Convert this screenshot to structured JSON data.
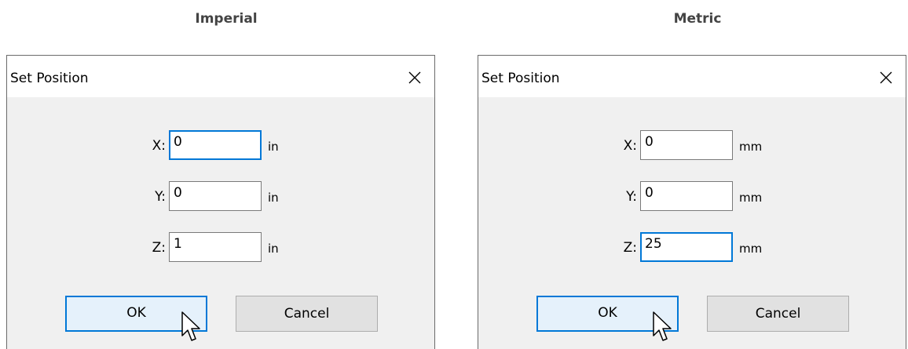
{
  "headings": {
    "left": "Imperial",
    "right": "Metric"
  },
  "dialogs": [
    {
      "title": "Set Position",
      "fields": [
        {
          "label": "X:",
          "value": "0",
          "unit": "in",
          "focused": true
        },
        {
          "label": "Y:",
          "value": "0",
          "unit": "in",
          "focused": false
        },
        {
          "label": "Z:",
          "value": "1",
          "unit": "in",
          "focused": false
        }
      ],
      "ok_label": "OK",
      "cancel_label": "Cancel"
    },
    {
      "title": "Set Position",
      "fields": [
        {
          "label": "X:",
          "value": "0",
          "unit": "mm",
          "focused": false
        },
        {
          "label": "Y:",
          "value": "0",
          "unit": "mm",
          "focused": false
        },
        {
          "label": "Z:",
          "value": "25",
          "unit": "mm",
          "focused": true
        }
      ],
      "ok_label": "OK",
      "cancel_label": "Cancel"
    }
  ],
  "icons": {
    "close": "close-icon",
    "cursor": "mouse-pointer-icon"
  },
  "colors": {
    "focus_border": "#0078d7",
    "dialog_bg": "#f0f0f0",
    "ok_bg": "#e5f1fb"
  }
}
